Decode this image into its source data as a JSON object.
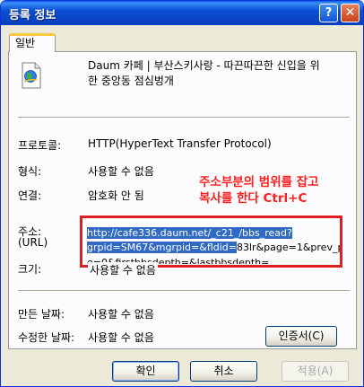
{
  "window": {
    "title": "등록 정보"
  },
  "titlebar": {
    "help_glyph": "?",
    "close_glyph": "✕"
  },
  "tabs": [
    {
      "label": "일반",
      "active": true
    }
  ],
  "general": {
    "title_line1": "Daum 카페 | 부산스키사랑 - 따끈따끈한 신입을 위",
    "title_line2": "한 중앙동 점심벙개",
    "protocol_label": "프로토콜:",
    "protocol_value": "HTTP(HyperText Transfer Protocol)",
    "type_label": "형식:",
    "type_value": "사용할 수 없음",
    "connection_label": "연결:",
    "connection_value": "암호화 안 됨",
    "address_label": "주소:",
    "address_label2": "(URL)",
    "url_line1": "http://cafe336.daum.net/_c21_/bbs_read?",
    "url_line2_selected": "grpid=SM67&mgrpid=&fldid=",
    "url_line2_rest": "83lr&page=1&prev_pag",
    "url_line3_partial": "e=0&firstbbsdepth=&lastbbsdepth=",
    "size_label": "크기:",
    "size_value": "사용할 수 없음",
    "created_label": "만든 날짜:",
    "created_value": "사용할 수 없음",
    "modified_label": "수정한 날짜:",
    "modified_value": "사용할 수 없음",
    "certificate_button": "인증서(C)"
  },
  "annotation": {
    "line1": "주소부분의 범위를 잡고",
    "line2": "복사를 한다 Ctrl+C",
    "color": "#ff2020"
  },
  "buttons": {
    "ok": "확인",
    "cancel": "취소",
    "apply": "적용(A)"
  }
}
